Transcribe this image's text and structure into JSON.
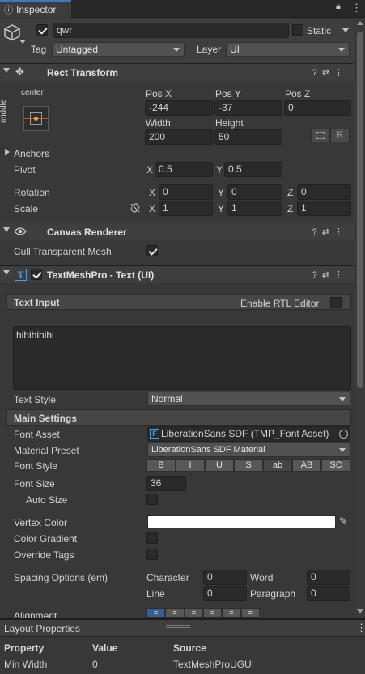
{
  "tab": {
    "title": "Inspector"
  },
  "gameobject": {
    "name": "qwr",
    "static_label": "Static",
    "tag_label": "Tag",
    "tag_value": "Untagged",
    "layer_label": "Layer",
    "layer_value": "UI"
  },
  "rect_transform": {
    "title": "Rect Transform",
    "anchor_preset_top": "center",
    "anchor_preset_side": "middle",
    "pos_x_label": "Pos X",
    "pos_x": "-244",
    "pos_y_label": "Pos Y",
    "pos_y": "-37",
    "pos_z_label": "Pos Z",
    "pos_z": "0",
    "width_label": "Width",
    "width": "200",
    "height_label": "Height",
    "height": "50",
    "r_label": "R",
    "anchors_label": "Anchors",
    "pivot_label": "Pivot",
    "pivot_x": "0.5",
    "pivot_y": "0.5",
    "rotation_label": "Rotation",
    "rot_x": "0",
    "rot_y": "0",
    "rot_z": "0",
    "scale_label": "Scale",
    "scale_x": "1",
    "scale_y": "1",
    "scale_z": "1",
    "x": "X",
    "y": "Y",
    "z": "Z"
  },
  "canvas_renderer": {
    "title": "Canvas Renderer",
    "cull_label": "Cull Transparent Mesh"
  },
  "tmp": {
    "title": "TextMeshPro - Text (UI)",
    "text_input_label": "Text Input",
    "rtl_label": "Enable RTL Editor",
    "text": "hihihihihi",
    "text_style_label": "Text Style",
    "text_style": "Normal",
    "main_settings": "Main Settings",
    "font_asset_label": "Font Asset",
    "font_asset": "LiberationSans SDF (TMP_Font Asset)",
    "material_label": "Material Preset",
    "material": "LiberationSans SDF Material",
    "font_style_label": "Font Style",
    "font_styles": [
      "B",
      "I",
      "U",
      "S",
      "ab",
      "AB",
      "SC"
    ],
    "font_size_label": "Font Size",
    "font_size": "36",
    "auto_size_label": "Auto Size",
    "vertex_color_label": "Vertex Color",
    "vertex_color": "#ffffff",
    "color_gradient_label": "Color Gradient",
    "override_tags_label": "Override Tags",
    "spacing_label": "Spacing Options (em)",
    "character_label": "Character",
    "character": "0",
    "word_label": "Word",
    "word": "0",
    "line_label": "Line",
    "line": "0",
    "paragraph_label": "Paragraph",
    "paragraph": "0",
    "alignment_label": "Alignment"
  },
  "layout": {
    "title": "Layout Properties",
    "col_property": "Property",
    "col_value": "Value",
    "col_source": "Source",
    "rows": [
      {
        "property": "Min Width",
        "value": "0",
        "source": "TextMeshProUGUI"
      }
    ]
  }
}
